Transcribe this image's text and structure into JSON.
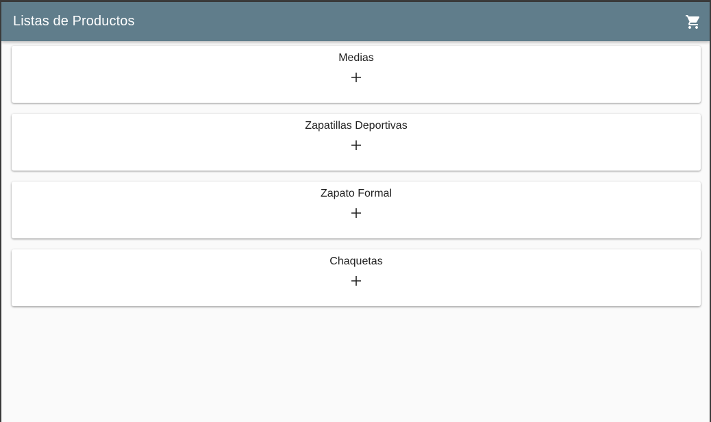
{
  "appbar": {
    "title": "Listas de Productos",
    "cart_icon": "shopping-cart-icon",
    "background": "#607d8b"
  },
  "products": [
    {
      "label": "Medias",
      "action_icon": "plus-icon"
    },
    {
      "label": "Zapatillas Deportivas",
      "action_icon": "plus-icon"
    },
    {
      "label": "Zapato Formal",
      "action_icon": "plus-icon"
    },
    {
      "label": "Chaquetas",
      "action_icon": "plus-icon"
    }
  ]
}
